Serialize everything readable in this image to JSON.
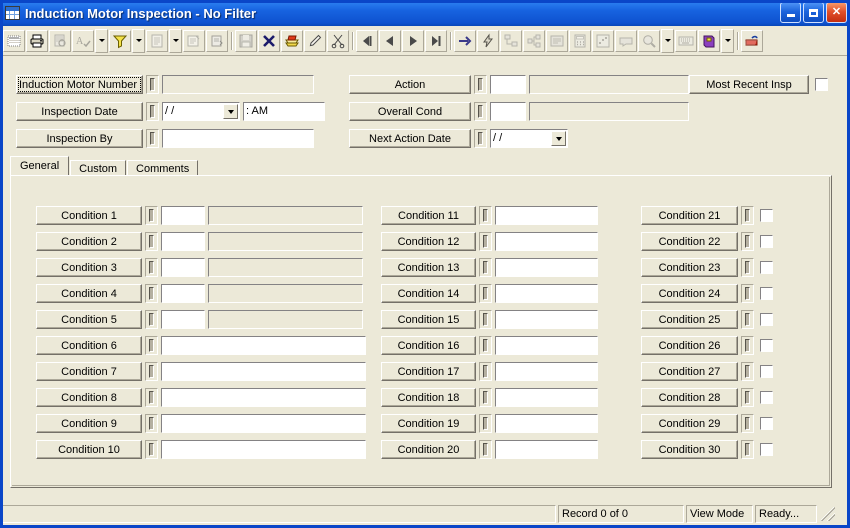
{
  "window": {
    "title": "Induction Motor Inspection - No Filter",
    "app_icon": "datasheet-icon",
    "buttons": {
      "minimize": "minimize-button",
      "maximize": "maximize-button",
      "close": "close-button"
    }
  },
  "toolbar": {
    "items": [
      {
        "name": "design-view-icon",
        "enabled": true
      },
      {
        "name": "print-icon",
        "enabled": true
      },
      {
        "name": "print-preview-icon",
        "enabled": false
      },
      {
        "name": "spell-check-icon",
        "enabled": false,
        "has_dropdown": true
      },
      {
        "name": "filter-icon",
        "enabled": true,
        "has_dropdown": true
      },
      {
        "name": "new-record-icon",
        "enabled": false,
        "has_dropdown": true
      },
      {
        "name": "properties-icon",
        "enabled": false
      },
      {
        "name": "refresh-icon",
        "enabled": true
      },
      {
        "separator": true
      },
      {
        "name": "save-icon",
        "enabled": false
      },
      {
        "name": "delete-icon",
        "enabled": true
      },
      {
        "name": "undo-icon",
        "enabled": true
      },
      {
        "name": "edit-pencil-icon",
        "enabled": true
      },
      {
        "name": "cut-scissors-icon",
        "enabled": true
      },
      {
        "separator": true
      },
      {
        "name": "first-record-icon",
        "enabled": true
      },
      {
        "name": "previous-record-icon",
        "enabled": true
      },
      {
        "name": "next-record-icon",
        "enabled": true
      },
      {
        "name": "last-record-icon",
        "enabled": true
      },
      {
        "separator": true
      },
      {
        "name": "goto-icon",
        "enabled": true
      },
      {
        "name": "lightning-icon",
        "enabled": true
      },
      {
        "name": "hierarchy-icon",
        "enabled": false
      },
      {
        "name": "org-chart-icon",
        "enabled": false
      },
      {
        "name": "list-icon",
        "enabled": false
      },
      {
        "name": "calculator-icon",
        "enabled": false
      },
      {
        "name": "scatter-icon",
        "enabled": false
      },
      {
        "name": "note-icon",
        "enabled": false
      },
      {
        "name": "search-magnifier-icon",
        "enabled": false,
        "has_dropdown": true
      },
      {
        "name": "keyboard-icon",
        "enabled": false
      },
      {
        "name": "help-book-icon",
        "enabled": true,
        "has_dropdown": true
      },
      {
        "separator": true
      },
      {
        "name": "export-icon",
        "enabled": true
      }
    ]
  },
  "header": {
    "fields": [
      {
        "label": "Induction Motor Number",
        "value": "",
        "focused": true,
        "control": "text"
      },
      {
        "label": "Inspection Date",
        "value": "  /  /",
        "value2": "    :    AM",
        "control": "date-combo"
      },
      {
        "label": "Inspection By",
        "value": "",
        "control": "text"
      },
      {
        "label": "Action",
        "value": "",
        "value2": "",
        "control": "code-text"
      },
      {
        "label": "Overall Cond",
        "value": "",
        "value2": "",
        "control": "code-text"
      },
      {
        "label": "Next Action Date",
        "value": "  /  /",
        "control": "date-combo"
      }
    ],
    "most_recent_insp": {
      "label": "Most Recent Insp",
      "checked": false
    }
  },
  "tabs": [
    {
      "label": "General",
      "active": true
    },
    {
      "label": "Custom",
      "active": false
    },
    {
      "label": "Comments",
      "active": false
    }
  ],
  "conditions": {
    "column1": [
      {
        "label": "Condition 1",
        "style": "code-plus-desc"
      },
      {
        "label": "Condition 2",
        "style": "code-plus-desc"
      },
      {
        "label": "Condition 3",
        "style": "code-plus-desc"
      },
      {
        "label": "Condition 4",
        "style": "code-plus-desc"
      },
      {
        "label": "Condition 5",
        "style": "code-plus-desc"
      },
      {
        "label": "Condition 6",
        "style": "wide-text"
      },
      {
        "label": "Condition 7",
        "style": "wide-text"
      },
      {
        "label": "Condition 8",
        "style": "wide-text"
      },
      {
        "label": "Condition 9",
        "style": "wide-text"
      },
      {
        "label": "Condition 10",
        "style": "wide-text"
      }
    ],
    "column2": [
      {
        "label": "Condition 11",
        "style": "wide-text"
      },
      {
        "label": "Condition 12",
        "style": "wide-text"
      },
      {
        "label": "Condition 13",
        "style": "wide-text"
      },
      {
        "label": "Condition 14",
        "style": "wide-text"
      },
      {
        "label": "Condition 15",
        "style": "wide-text"
      },
      {
        "label": "Condition 16",
        "style": "wide-text"
      },
      {
        "label": "Condition 17",
        "style": "wide-text"
      },
      {
        "label": "Condition 18",
        "style": "wide-text"
      },
      {
        "label": "Condition 19",
        "style": "wide-text"
      },
      {
        "label": "Condition 20",
        "style": "wide-text"
      }
    ],
    "column3": [
      {
        "label": "Condition 21",
        "style": "checkbox",
        "checked": false
      },
      {
        "label": "Condition 22",
        "style": "checkbox",
        "checked": false
      },
      {
        "label": "Condition 23",
        "style": "checkbox",
        "checked": false
      },
      {
        "label": "Condition 24",
        "style": "checkbox",
        "checked": false
      },
      {
        "label": "Condition 25",
        "style": "checkbox",
        "checked": false
      },
      {
        "label": "Condition 26",
        "style": "checkbox",
        "checked": false
      },
      {
        "label": "Condition 27",
        "style": "checkbox",
        "checked": false
      },
      {
        "label": "Condition 28",
        "style": "checkbox",
        "checked": false
      },
      {
        "label": "Condition 29",
        "style": "checkbox",
        "checked": false
      },
      {
        "label": "Condition 30",
        "style": "checkbox",
        "checked": false
      }
    ]
  },
  "statusbar": {
    "record": "Record 0 of 0",
    "mode": "View Mode",
    "state": "Ready..."
  },
  "colors": {
    "titlebar": "#0a56d6",
    "face": "#ece9d8",
    "border": "#0a46c8",
    "field": "#ffffff",
    "shadow": "#aca899"
  }
}
